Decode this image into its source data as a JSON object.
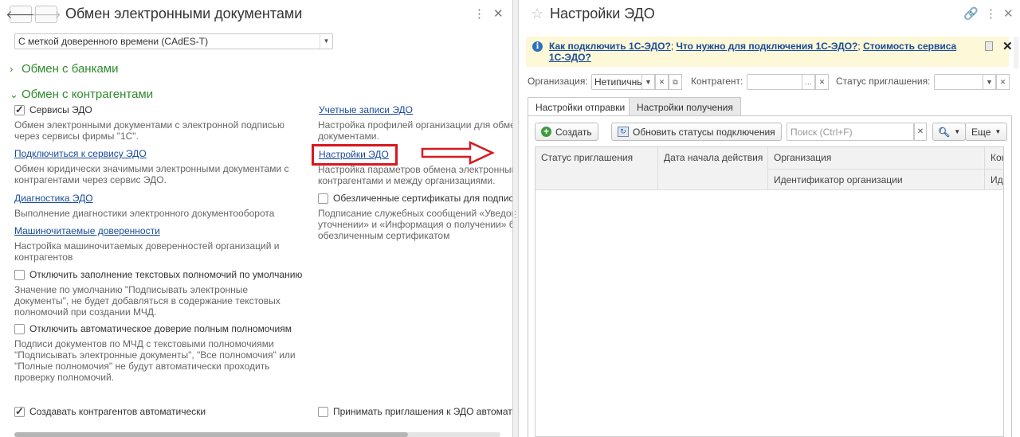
{
  "left": {
    "title": "Обмен электронными документами",
    "signature_type": "С меткой доверенного времени (CAdES-T)",
    "groups": {
      "banks": "Обмен с банками",
      "counterparties": "Обмен с контрагентами"
    },
    "services_edo": {
      "label": "Сервисы ЭДО",
      "checked": true,
      "desc": [
        "Обмен электронными документами с электронной подписью",
        "через сервисы фирмы \"1С\"."
      ]
    },
    "connect_service": {
      "label": "Подключиться к сервису ЭДО",
      "desc": [
        "Обмен юридически значимыми электронными документами с",
        "контрагентами через сервис ЭДО."
      ]
    },
    "diagnostics": {
      "label": "Диагностика ЭДО",
      "desc": [
        "Выполнение диагностики электронного документооборота"
      ]
    },
    "mchd": {
      "label": "Машиночитаемые доверенности",
      "desc": [
        "Настройка машиночитаемых доверенностей организаций и",
        "контрагентов"
      ]
    },
    "disable_text_powers": {
      "label": "Отключить заполнение текстовых полномочий по умолчанию",
      "checked": false,
      "desc": [
        "Значение по умолчанию \"Подписывать электронные",
        "документы\", не будет добавляться в содержание текстовых",
        "полномочий при создании МЧД."
      ]
    },
    "disable_auto_trust": {
      "label": "Отключить автоматическое доверие полным полномочиям",
      "checked": false,
      "desc": [
        "Подписи документов по МЧД с текстовыми полномочиями",
        "\"Подписывать электронные документы\", \"Все полномочия\" или",
        "\"Полные полномочия\" не будут автоматически проходить",
        "проверку полномочий."
      ]
    },
    "create_auto": {
      "label": "Создавать контрагентов автоматически",
      "checked": true
    },
    "accounts": {
      "label": "Учетные записи ЭДО",
      "desc": [
        "Настройка профилей организации для обмен",
        "документами."
      ]
    },
    "edo_settings": {
      "label": "Настройки ЭДО",
      "desc": [
        "Настройка параметров обмена электронными",
        "контрагентами и между организациями."
      ]
    },
    "impersonal_certs": {
      "label": "Обезличенные сертификаты для подписи",
      "checked": false,
      "desc": [
        "Подписание служебных сообщений «Уведомл",
        "уточнении» и «Информация о получении» бу",
        "обезличенным сертификатом"
      ]
    },
    "accept_invites": {
      "label": "Принимать приглашения к ЭДО автомати",
      "checked": false
    },
    "scroll_fraction": 0.81
  },
  "right": {
    "title": "Настройки ЭДО",
    "info_links": [
      "Как подключить 1С-ЭДО?",
      "Что нужно для подключения 1С-ЭДО?",
      "Стоимость сервиса 1С-ЭДО?"
    ],
    "info_sep": ";",
    "filters": {
      "org_label": "Организация:",
      "org_value": "Нетипичнь",
      "counterparty_label": "Контрагент:",
      "counterparty_value": "",
      "status_label": "Статус приглашения:",
      "status_value": ""
    },
    "tabs": [
      "Настройки отправки",
      "Настройки получения"
    ],
    "toolbar": {
      "create": "Создать",
      "refresh": "Обновить статусы подключения",
      "search_placeholder": "Поиск (Ctrl+F)",
      "more": "Еще"
    },
    "columns": {
      "status": "Статус приглашения",
      "start_date": "Дата начала действия",
      "org": "Организация",
      "org_id": "Идентификатор организации",
      "next": "Кон",
      "next_sub": "Иде"
    }
  },
  "colors": {
    "group_green": "#2e8b2e",
    "link_blue": "#1a4a9a",
    "highlight_red": "#d8171f",
    "info_bg": "#fcf8d8"
  }
}
